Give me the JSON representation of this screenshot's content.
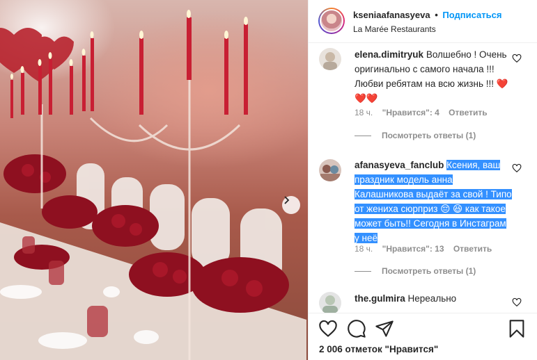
{
  "post": {
    "username": "kseniaafanasyeva",
    "separator": "•",
    "follow_label": "Подписаться",
    "location": "La Marée Restaurants"
  },
  "comments": [
    {
      "username": "elena.dimitryuk",
      "text": "Волшебно ! Очень оригинально с самого начала !!! Любви ребятам на всю жизнь !!!",
      "hearts": "❤️❤️❤️",
      "time": "18 ч.",
      "likes": "\"Нравится\": 4",
      "reply": "Ответить",
      "view_replies": "Посмотреть ответы (1)"
    },
    {
      "username": "afanasyeva_fanclub",
      "text": "Ксения, ваш праздник модель анна Калашникова выдаёт за свой ! Типо от жениха сюрприз 😔 😆 как такое может быть!! Сегодня в Инстаграм у неё",
      "time": "18 ч.",
      "likes": "\"Нравится\": 13",
      "reply": "Ответить",
      "view_replies": "Посмотреть ответы (1)"
    },
    {
      "username": "the.gulmira",
      "text": "Нереально"
    }
  ],
  "footer": {
    "likes_count": "2 006 отметок \"Нравится\""
  },
  "icons": {
    "like": "heart-icon",
    "comment": "comment-icon",
    "share": "share-icon",
    "save": "bookmark-icon",
    "next": "chevron-right-icon"
  },
  "colors": {
    "link_blue": "#0095f6",
    "selection": "#3390ff",
    "muted": "#8e8e8e",
    "heart_red": "#ed4956"
  }
}
